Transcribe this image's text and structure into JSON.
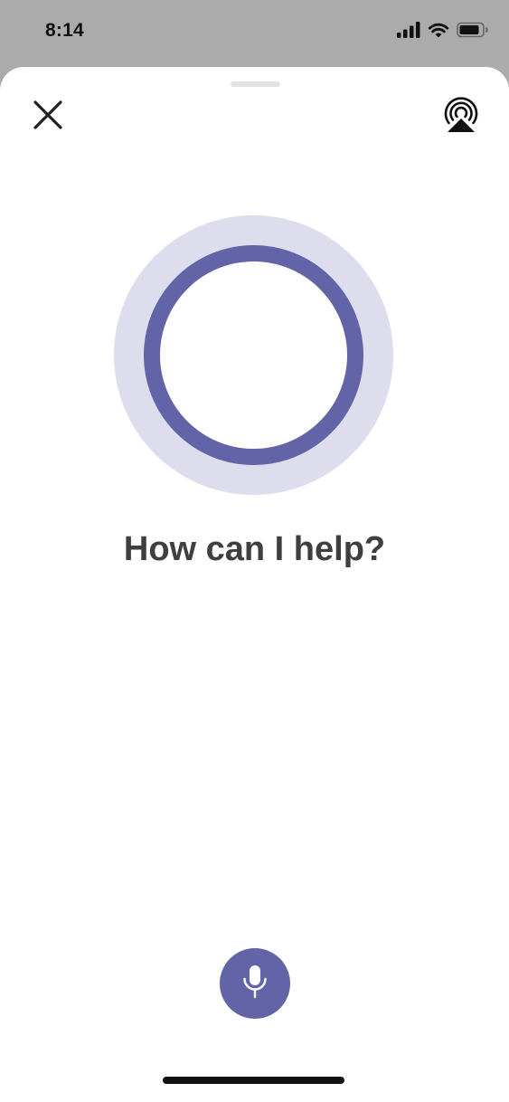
{
  "status_bar": {
    "time": "8:14",
    "icons": [
      "cellular-signal-icon",
      "wifi-icon",
      "battery-icon"
    ]
  },
  "header": {
    "close_icon": "close-icon",
    "airplay_icon": "airplay-icon"
  },
  "assistant": {
    "prompt": "How can I help?",
    "accent_color": "#6264a7",
    "halo_color": "#dedded"
  },
  "footer": {
    "mic_icon": "microphone-icon"
  }
}
